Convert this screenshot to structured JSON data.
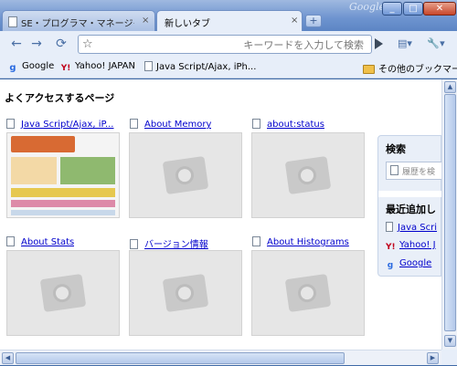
{
  "window": {
    "brand": "Google",
    "minimize_glyph": "_",
    "maximize_glyph": "□",
    "close_glyph": "✕"
  },
  "tabs": [
    {
      "title": "SE・プログラマ・マネージャーの...",
      "close": "×",
      "active": false
    },
    {
      "title": "新しいタブ",
      "close": "×",
      "active": true
    }
  ],
  "new_tab_glyph": "+",
  "toolbar": {
    "back_icon": "←",
    "forward_icon": "→",
    "reload_icon": "⟳",
    "star_icon": "☆",
    "omnibox_placeholder": "キーワードを入力して検索",
    "page_menu_icon": "▤▾",
    "wrench_icon": "🔧▾"
  },
  "bookmarks": [
    {
      "label": "Google",
      "icon": "google-icon"
    },
    {
      "label": "Yahoo! JAPAN",
      "icon": "yahoo-icon"
    },
    {
      "label": "Java Script/Ajax, iPh...",
      "icon": "page-icon"
    }
  ],
  "other_bookmarks": "その他のブックマーク",
  "most_visited": {
    "title": "よくアクセスするページ",
    "items": [
      {
        "label": "Java Script/Ajax, iP..."
      },
      {
        "label": "About Memory"
      },
      {
        "label": "about:status"
      },
      {
        "label": "About Stats"
      },
      {
        "label": "バージョン情報"
      },
      {
        "label": "About Histograms"
      }
    ]
  },
  "sidebar": {
    "search_title": "検索",
    "search_placeholder": "履歴を検",
    "recent_title": "最近追加し",
    "recent_items": [
      {
        "label": "Java Scri",
        "icon": "page-icon"
      },
      {
        "label": "Yahoo! J",
        "icon": "yahoo-icon"
      },
      {
        "label": "Google",
        "icon": "google-icon"
      }
    ]
  },
  "colors": {
    "frame": "#3e69a6",
    "link": "#0000cc",
    "toolbar": "#e7eef9"
  }
}
